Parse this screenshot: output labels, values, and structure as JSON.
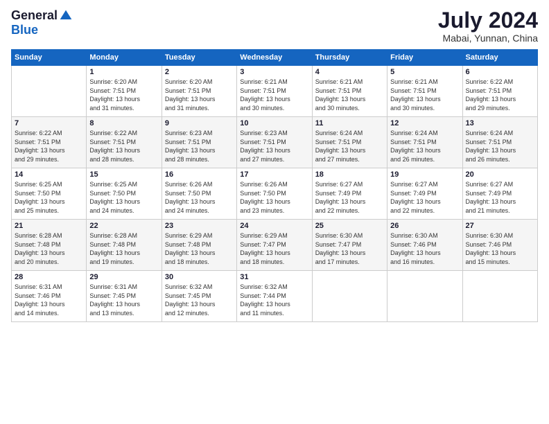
{
  "logo": {
    "general": "General",
    "blue": "Blue"
  },
  "title": {
    "month_year": "July 2024",
    "location": "Mabai, Yunnan, China"
  },
  "days_of_week": [
    "Sunday",
    "Monday",
    "Tuesday",
    "Wednesday",
    "Thursday",
    "Friday",
    "Saturday"
  ],
  "weeks": [
    [
      {
        "day": "",
        "sunrise": "",
        "sunset": "",
        "daylight": ""
      },
      {
        "day": "1",
        "sunrise": "Sunrise: 6:20 AM",
        "sunset": "Sunset: 7:51 PM",
        "daylight": "Daylight: 13 hours and 31 minutes."
      },
      {
        "day": "2",
        "sunrise": "Sunrise: 6:20 AM",
        "sunset": "Sunset: 7:51 PM",
        "daylight": "Daylight: 13 hours and 31 minutes."
      },
      {
        "day": "3",
        "sunrise": "Sunrise: 6:21 AM",
        "sunset": "Sunset: 7:51 PM",
        "daylight": "Daylight: 13 hours and 30 minutes."
      },
      {
        "day": "4",
        "sunrise": "Sunrise: 6:21 AM",
        "sunset": "Sunset: 7:51 PM",
        "daylight": "Daylight: 13 hours and 30 minutes."
      },
      {
        "day": "5",
        "sunrise": "Sunrise: 6:21 AM",
        "sunset": "Sunset: 7:51 PM",
        "daylight": "Daylight: 13 hours and 30 minutes."
      },
      {
        "day": "6",
        "sunrise": "Sunrise: 6:22 AM",
        "sunset": "Sunset: 7:51 PM",
        "daylight": "Daylight: 13 hours and 29 minutes."
      }
    ],
    [
      {
        "day": "7",
        "sunrise": "Sunrise: 6:22 AM",
        "sunset": "Sunset: 7:51 PM",
        "daylight": "Daylight: 13 hours and 29 minutes."
      },
      {
        "day": "8",
        "sunrise": "Sunrise: 6:22 AM",
        "sunset": "Sunset: 7:51 PM",
        "daylight": "Daylight: 13 hours and 28 minutes."
      },
      {
        "day": "9",
        "sunrise": "Sunrise: 6:23 AM",
        "sunset": "Sunset: 7:51 PM",
        "daylight": "Daylight: 13 hours and 28 minutes."
      },
      {
        "day": "10",
        "sunrise": "Sunrise: 6:23 AM",
        "sunset": "Sunset: 7:51 PM",
        "daylight": "Daylight: 13 hours and 27 minutes."
      },
      {
        "day": "11",
        "sunrise": "Sunrise: 6:24 AM",
        "sunset": "Sunset: 7:51 PM",
        "daylight": "Daylight: 13 hours and 27 minutes."
      },
      {
        "day": "12",
        "sunrise": "Sunrise: 6:24 AM",
        "sunset": "Sunset: 7:51 PM",
        "daylight": "Daylight: 13 hours and 26 minutes."
      },
      {
        "day": "13",
        "sunrise": "Sunrise: 6:24 AM",
        "sunset": "Sunset: 7:51 PM",
        "daylight": "Daylight: 13 hours and 26 minutes."
      }
    ],
    [
      {
        "day": "14",
        "sunrise": "Sunrise: 6:25 AM",
        "sunset": "Sunset: 7:50 PM",
        "daylight": "Daylight: 13 hours and 25 minutes."
      },
      {
        "day": "15",
        "sunrise": "Sunrise: 6:25 AM",
        "sunset": "Sunset: 7:50 PM",
        "daylight": "Daylight: 13 hours and 24 minutes."
      },
      {
        "day": "16",
        "sunrise": "Sunrise: 6:26 AM",
        "sunset": "Sunset: 7:50 PM",
        "daylight": "Daylight: 13 hours and 24 minutes."
      },
      {
        "day": "17",
        "sunrise": "Sunrise: 6:26 AM",
        "sunset": "Sunset: 7:50 PM",
        "daylight": "Daylight: 13 hours and 23 minutes."
      },
      {
        "day": "18",
        "sunrise": "Sunrise: 6:27 AM",
        "sunset": "Sunset: 7:49 PM",
        "daylight": "Daylight: 13 hours and 22 minutes."
      },
      {
        "day": "19",
        "sunrise": "Sunrise: 6:27 AM",
        "sunset": "Sunset: 7:49 PM",
        "daylight": "Daylight: 13 hours and 22 minutes."
      },
      {
        "day": "20",
        "sunrise": "Sunrise: 6:27 AM",
        "sunset": "Sunset: 7:49 PM",
        "daylight": "Daylight: 13 hours and 21 minutes."
      }
    ],
    [
      {
        "day": "21",
        "sunrise": "Sunrise: 6:28 AM",
        "sunset": "Sunset: 7:48 PM",
        "daylight": "Daylight: 13 hours and 20 minutes."
      },
      {
        "day": "22",
        "sunrise": "Sunrise: 6:28 AM",
        "sunset": "Sunset: 7:48 PM",
        "daylight": "Daylight: 13 hours and 19 minutes."
      },
      {
        "day": "23",
        "sunrise": "Sunrise: 6:29 AM",
        "sunset": "Sunset: 7:48 PM",
        "daylight": "Daylight: 13 hours and 18 minutes."
      },
      {
        "day": "24",
        "sunrise": "Sunrise: 6:29 AM",
        "sunset": "Sunset: 7:47 PM",
        "daylight": "Daylight: 13 hours and 18 minutes."
      },
      {
        "day": "25",
        "sunrise": "Sunrise: 6:30 AM",
        "sunset": "Sunset: 7:47 PM",
        "daylight": "Daylight: 13 hours and 17 minutes."
      },
      {
        "day": "26",
        "sunrise": "Sunrise: 6:30 AM",
        "sunset": "Sunset: 7:46 PM",
        "daylight": "Daylight: 13 hours and 16 minutes."
      },
      {
        "day": "27",
        "sunrise": "Sunrise: 6:30 AM",
        "sunset": "Sunset: 7:46 PM",
        "daylight": "Daylight: 13 hours and 15 minutes."
      }
    ],
    [
      {
        "day": "28",
        "sunrise": "Sunrise: 6:31 AM",
        "sunset": "Sunset: 7:46 PM",
        "daylight": "Daylight: 13 hours and 14 minutes."
      },
      {
        "day": "29",
        "sunrise": "Sunrise: 6:31 AM",
        "sunset": "Sunset: 7:45 PM",
        "daylight": "Daylight: 13 hours and 13 minutes."
      },
      {
        "day": "30",
        "sunrise": "Sunrise: 6:32 AM",
        "sunset": "Sunset: 7:45 PM",
        "daylight": "Daylight: 13 hours and 12 minutes."
      },
      {
        "day": "31",
        "sunrise": "Sunrise: 6:32 AM",
        "sunset": "Sunset: 7:44 PM",
        "daylight": "Daylight: 13 hours and 11 minutes."
      },
      {
        "day": "",
        "sunrise": "",
        "sunset": "",
        "daylight": ""
      },
      {
        "day": "",
        "sunrise": "",
        "sunset": "",
        "daylight": ""
      },
      {
        "day": "",
        "sunrise": "",
        "sunset": "",
        "daylight": ""
      }
    ]
  ]
}
